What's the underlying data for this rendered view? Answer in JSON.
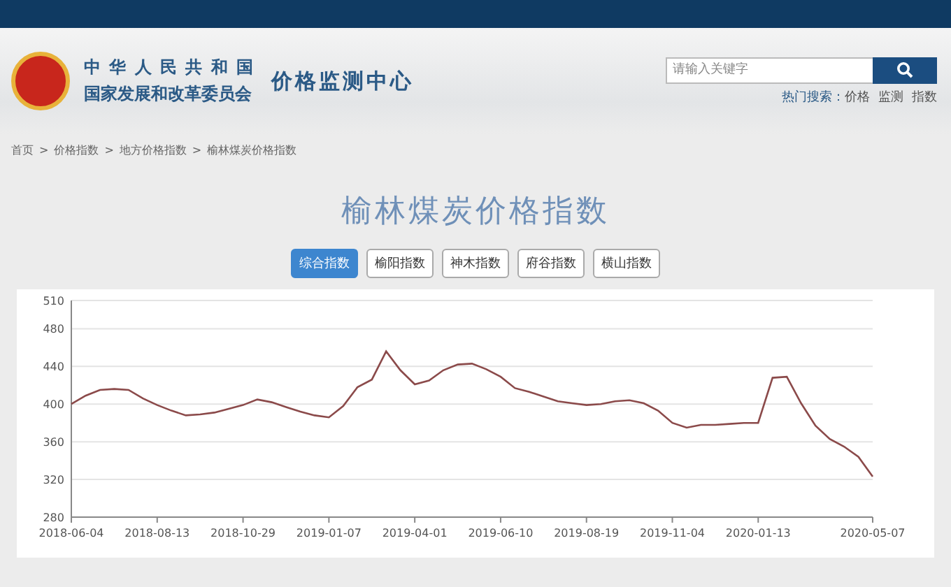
{
  "header": {
    "org_line_1": "中 华 人 民 共 和 国",
    "org_line_2": "国家发展和改革委员会",
    "center_name": "价格监测中心",
    "search": {
      "placeholder": "请输入关键字"
    },
    "hot_search": {
      "label": "热门搜索：",
      "terms": [
        "价格",
        "监测",
        "指数"
      ]
    }
  },
  "breadcrumb": {
    "links": [
      "首页",
      "价格指数",
      "地方价格指数",
      "榆林煤炭价格指数"
    ],
    "separators": [
      ">",
      ">",
      ">"
    ]
  },
  "page_title": "榆林煤炭价格指数",
  "tabs": [
    {
      "label": "综合指数",
      "selected": true
    },
    {
      "label": "榆阳指数",
      "selected": false
    },
    {
      "label": "神木指数",
      "selected": false
    },
    {
      "label": "府谷指数",
      "selected": false
    },
    {
      "label": "横山指数",
      "selected": false
    }
  ],
  "chart_data": {
    "type": "line",
    "grid": true,
    "ylim": [
      280,
      510
    ],
    "yticks": [
      280,
      320,
      360,
      400,
      440,
      480,
      510
    ],
    "categories": [
      "2018-06-04",
      null,
      null,
      null,
      null,
      null,
      "2018-08-13",
      null,
      null,
      null,
      null,
      null,
      "2018-10-29",
      null,
      null,
      null,
      null,
      null,
      "2019-01-07",
      null,
      null,
      null,
      null,
      null,
      "2019-04-01",
      null,
      null,
      null,
      null,
      null,
      "2019-06-10",
      null,
      null,
      null,
      null,
      null,
      "2019-08-19",
      null,
      null,
      null,
      null,
      null,
      "2019-11-04",
      null,
      null,
      null,
      null,
      null,
      "2020-01-13",
      null,
      null,
      null,
      null,
      null,
      null,
      null,
      "2020-05-07"
    ],
    "series": [
      {
        "color": "#8b4a4a",
        "values": [
          400,
          409,
          415,
          416,
          415,
          406,
          399,
          393,
          388,
          389,
          391,
          395,
          399,
          405,
          402,
          397,
          392,
          388,
          386,
          398,
          418,
          426,
          456,
          436,
          421,
          425,
          436,
          442,
          443,
          437,
          429,
          417,
          413,
          408,
          403,
          401,
          399,
          400,
          403,
          404,
          401,
          393,
          380,
          375,
          378,
          378,
          379,
          380,
          380,
          428,
          429,
          401,
          377,
          363,
          355,
          344,
          323
        ]
      }
    ]
  }
}
